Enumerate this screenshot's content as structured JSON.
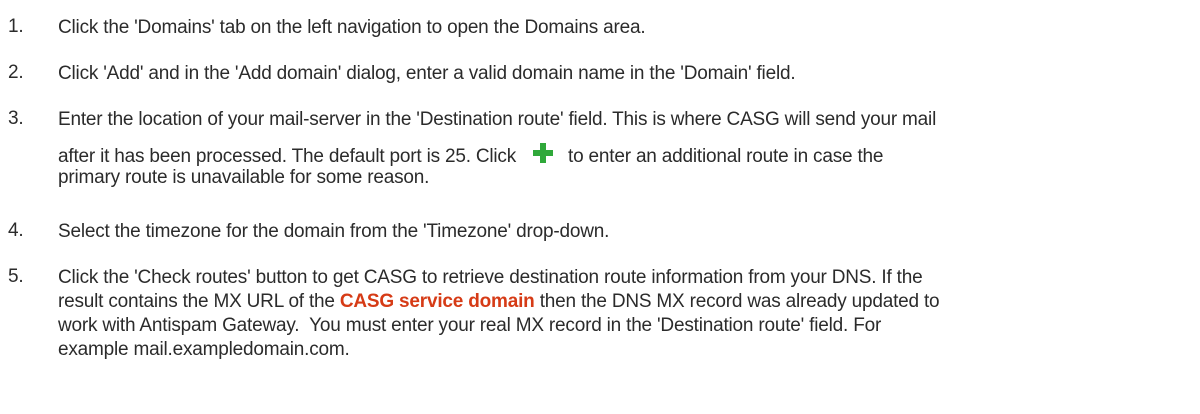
{
  "steps": [
    {
      "number": "1.",
      "lines": [
        "Click the 'Domains' tab on the left navigation to open the Domains area."
      ]
    },
    {
      "number": "2.",
      "lines": [
        "Click 'Add' and in the 'Add domain' dialog, enter a valid domain name in the 'Domain' field."
      ]
    },
    {
      "number": "3.",
      "line1": "Enter the location of your mail-server in the 'Destination route' field. This is where CASG will send your mail",
      "line2_before": "after it has been processed. The default port is 25. Click",
      "icon": "green-plus-icon",
      "line2_after": "to enter an additional route in case the",
      "line3": "primary route is unavailable for some reason."
    },
    {
      "number": "4.",
      "lines": [
        "Select the timezone for the domain from the 'Timezone' drop-down."
      ]
    },
    {
      "number": "5.",
      "line1": "Click the 'Check routes' button to get CASG to retrieve destination route information from your DNS. If the",
      "line2_before": "result contains the MX URL of the",
      "link_text": "CASG service domain",
      "line2_after": "then the DNS MX record was already updated to",
      "line3": "work with Antispam Gateway.  You must enter your real MX record in the 'Destination route' field. For",
      "line4": "example mail.exampledomain.com."
    }
  ],
  "colors": {
    "text": "#2b2b2b",
    "link": "#d63b16",
    "icon": "#2fa83a"
  }
}
